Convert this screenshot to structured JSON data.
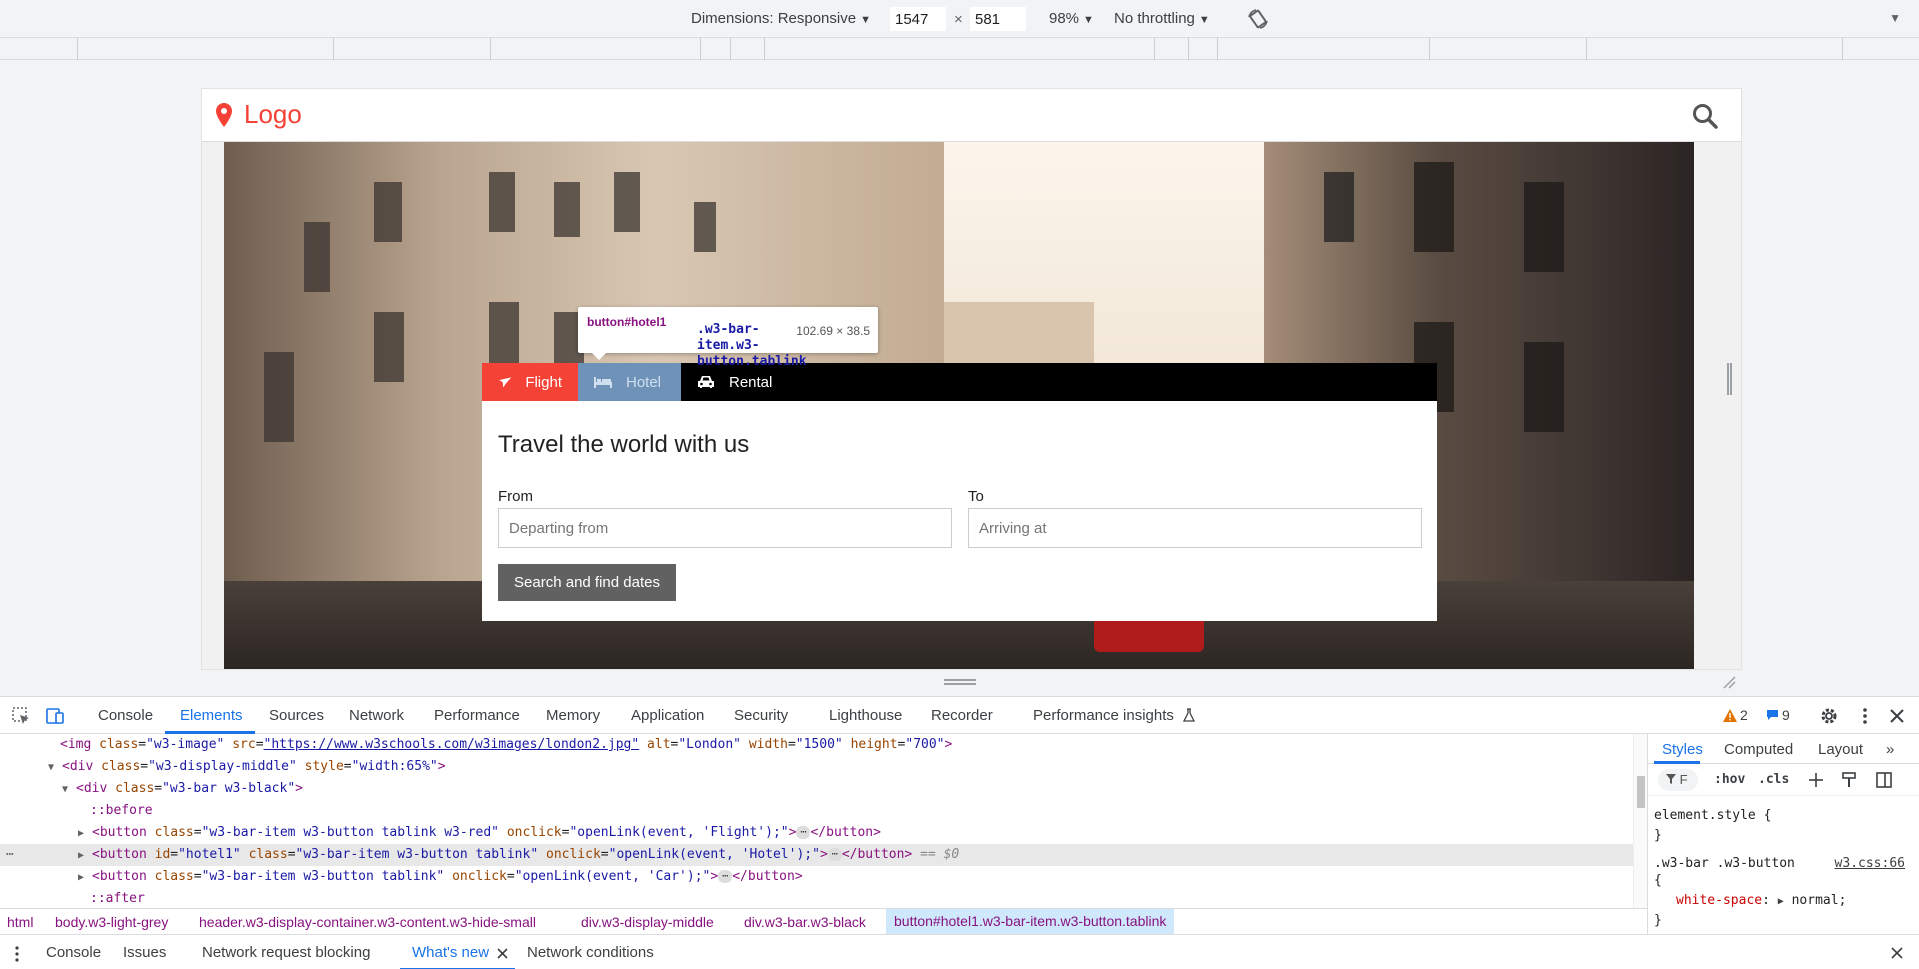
{
  "device_toolbar": {
    "dimensions_label": "Dimensions: Responsive",
    "width": "1547",
    "times": "×",
    "height": "581",
    "zoom": "98%",
    "throttling": "No throttling",
    "caret": "▼"
  },
  "site": {
    "logo_text": "Logo",
    "tabs": [
      {
        "label": "Flight",
        "icon": "plane-icon"
      },
      {
        "label": "Hotel",
        "icon": "bed-icon"
      },
      {
        "label": "Rental",
        "icon": "car-icon"
      }
    ],
    "heading": "Travel the world with us",
    "from_label": "From",
    "from_placeholder": "Departing from",
    "to_label": "To",
    "to_placeholder": "Arriving at",
    "search_button": "Search and find dates",
    "accent_color": "#f44336"
  },
  "tooltip": {
    "selector_tag": "button#hotel1",
    "selector_classes": ".w3-bar-item.w3-button.tablink",
    "size": "102.69 × 38.5"
  },
  "devtools": {
    "tabs": [
      "Console",
      "Elements",
      "Sources",
      "Network",
      "Performance",
      "Memory",
      "Application",
      "Security",
      "Lighthouse",
      "Recorder",
      "Performance insights"
    ],
    "active_tab": "Elements",
    "warnings_count": "2",
    "messages_count": "9",
    "code_lines": [
      {
        "indent": 60,
        "arrow": "",
        "html": "img"
      },
      {
        "indent": 48,
        "arrow": "▼",
        "html": "div-middle"
      },
      {
        "indent": 62,
        "arrow": "▼",
        "html": "div-bar"
      },
      {
        "indent": 90,
        "arrow": "",
        "html": "before"
      },
      {
        "indent": 78,
        "arrow": "▶",
        "html": "btn1"
      },
      {
        "indent": 78,
        "arrow": "▶",
        "html": "btn2"
      },
      {
        "indent": 78,
        "arrow": "▶",
        "html": "btn3"
      },
      {
        "indent": 90,
        "arrow": "",
        "html": "after"
      }
    ],
    "code": {
      "img": {
        "tag_open": "<img ",
        "a1": "class",
        "v1": "\"w3-image\"",
        "a2": "src",
        "v2": "\"https://www.w3schools.com/w3images/london2.jpg\"",
        "a3": "alt",
        "v3": "\"London\"",
        "a4": "width",
        "v4": "\"1500\"",
        "a5": "height",
        "v5": "\"700\"",
        "close": ">"
      },
      "div_middle": {
        "tag_open": "<div ",
        "a1": "class",
        "v1": "\"w3-display-middle\"",
        "a2": "style",
        "v2": "\"width:65%\"",
        "close": ">"
      },
      "div_bar": {
        "tag_open": "<div ",
        "a1": "class",
        "v1": "\"w3-bar w3-black\"",
        "close": ">"
      },
      "before": "::before",
      "btn1": {
        "tag_open": "<button ",
        "a1": "class",
        "v1": "\"w3-bar-item w3-button tablink w3-red\"",
        "a2": "onclick",
        "v2": "\"openLink(event, 'Flight');\"",
        "close": ">",
        "end": "</button>"
      },
      "btn2": {
        "tag_open": "<button ",
        "a0": "id",
        "v0": "\"hotel1\"",
        "a1": "class",
        "v1": "\"w3-bar-item w3-button tablink\"",
        "a2": "onclick",
        "v2": "\"openLink(event, 'Hotel');\"",
        "close": ">",
        "end": "</button>",
        "suffix": "== $0"
      },
      "btn3": {
        "tag_open": "<button ",
        "a1": "class",
        "v1": "\"w3-bar-item w3-button tablink\"",
        "a2": "onclick",
        "v2": "\"openLink(event, 'Car');\"",
        "close": ">",
        "end": "</button>"
      },
      "after": "::after",
      "ellipsis": "⋯"
    },
    "breadcrumbs": [
      "html",
      "body.w3-light-grey",
      "header.w3-display-container.w3-content.w3-hide-small",
      "div.w3-display-middle",
      "div.w3-bar.w3-black",
      "button#hotel1.w3-bar-item.w3-button.tablink"
    ],
    "styles": {
      "tabs": [
        "Styles",
        "Computed",
        "Layout"
      ],
      "filter_placeholder": "F",
      "hov": ":hov",
      "cls": ".cls",
      "element_style": "element.style {",
      "close_brace": "}",
      "rule_selector": ".w3-bar .w3-button",
      "rule_source": "w3.css:66",
      "open_brace": "{",
      "prop_name": "white-space",
      "prop_value": "normal;"
    },
    "drawer": {
      "tabs": [
        "Console",
        "Issues",
        "Network request blocking",
        "What's new",
        "Network conditions"
      ],
      "active": "What's new"
    }
  }
}
